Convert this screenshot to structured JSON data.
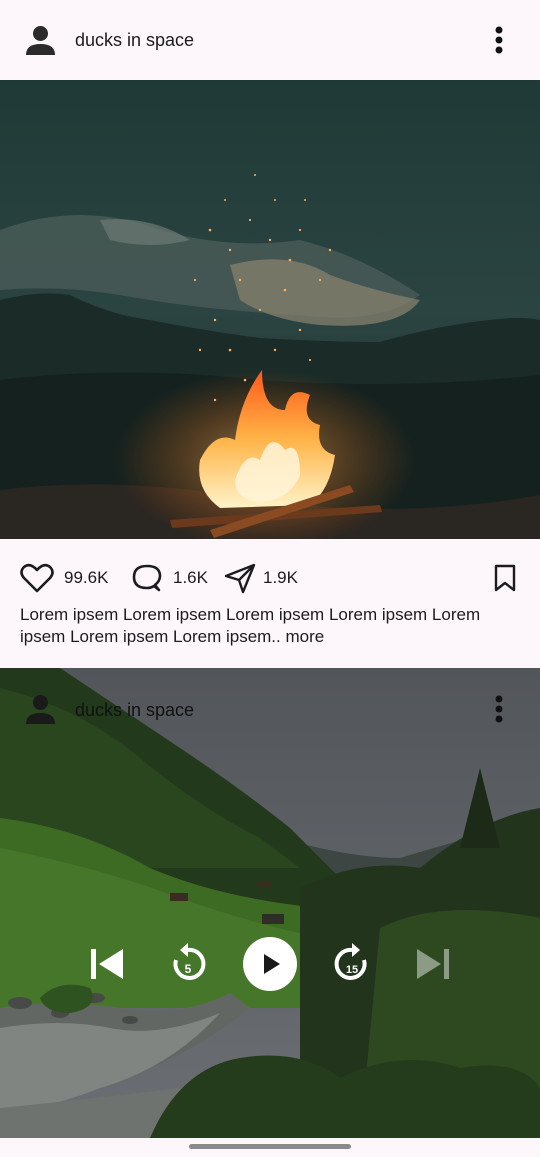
{
  "post": {
    "author": "ducks in space",
    "likes": "99.6K",
    "comments": "1.6K",
    "shares": "1.9K",
    "caption": "Lorem ipsem Lorem ipsem Lorem ipsem Lorem ipsem Lorem ipsem Lorem ipsem Lorem ipsem..",
    "more_label": "more"
  },
  "video_post": {
    "author": "ducks in space",
    "rewind_seconds": "5",
    "forward_seconds": "15"
  },
  "icons": {
    "avatar": "person-icon",
    "overflow": "more-vertical-icon",
    "like": "heart-icon",
    "comment": "comment-icon",
    "share": "send-icon",
    "save": "bookmark-icon",
    "prev": "skip-previous-icon",
    "rewind": "replay-5-icon",
    "play": "play-icon",
    "forward": "forward-15-icon",
    "next": "skip-next-icon"
  }
}
